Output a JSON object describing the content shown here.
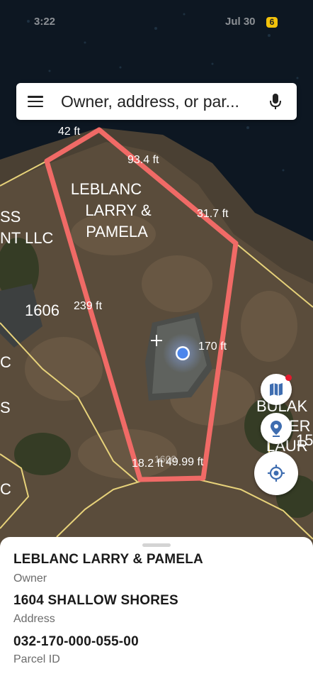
{
  "status_bar": {
    "time": "3:22",
    "date": "Jul 30",
    "notification_count": "6"
  },
  "search": {
    "placeholder": "Owner, address, or par..."
  },
  "map": {
    "owner_label_line1": "LEBLANC",
    "owner_label_line2": "LARRY &",
    "owner_label_line3": "PAMELA",
    "dimensions": {
      "top": "42 ft",
      "top_right": "93.4 ft",
      "right_upper": "31.7 ft",
      "left": "239 ft",
      "right": "170 ft",
      "bottom": "18.2 ft",
      "bottom2": "49.99 ft"
    },
    "neighbor_labels": {
      "left_upper_line1": "SS",
      "left_upper_line2": "NT LLC",
      "left_number": "1606",
      "left_c1": "C",
      "left_s": "S",
      "left_c2": "C",
      "right_line1": "BULAK",
      "right_line2": "S",
      "right_line3": "ER",
      "right_line4": "LAUR",
      "right_number": "15",
      "bottom_number": "1600"
    },
    "parcel_color": "#f06a66",
    "boundary_color": "#e7d27a"
  },
  "details": {
    "owner_value": "LEBLANC LARRY & PAMELA",
    "owner_label": "Owner",
    "address_value": "1604 SHALLOW SHORES",
    "address_label": "Address",
    "parcel_value": "032-170-000-055-00",
    "parcel_label": "Parcel ID"
  }
}
